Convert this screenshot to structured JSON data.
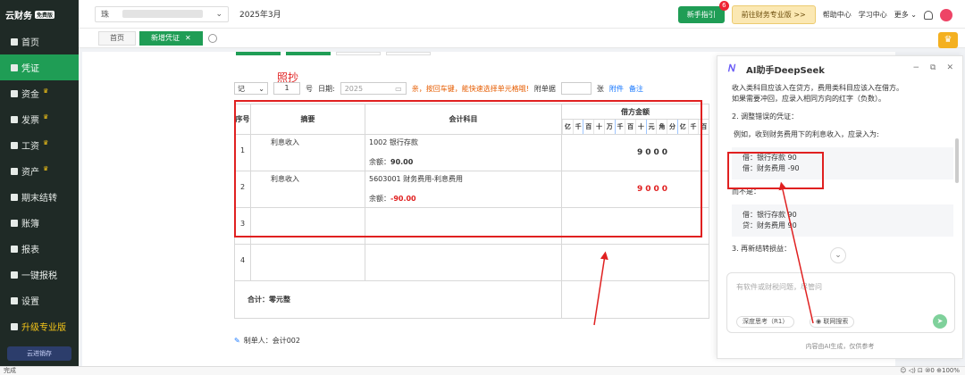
{
  "sidebar": {
    "logo": "云财务",
    "logo_badge": "免费版",
    "items": [
      {
        "label": "首页",
        "icon": "home-icon",
        "crown": false
      },
      {
        "label": "凭证",
        "icon": "voucher-icon",
        "crown": false
      },
      {
        "label": "资金",
        "icon": "fund-icon",
        "crown": true
      },
      {
        "label": "发票",
        "icon": "invoice-icon",
        "crown": true
      },
      {
        "label": "工资",
        "icon": "salary-icon",
        "crown": true
      },
      {
        "label": "资产",
        "icon": "asset-icon",
        "crown": true
      },
      {
        "label": "期末结转",
        "icon": "closing-icon",
        "crown": false
      },
      {
        "label": "账簿",
        "icon": "ledger-icon",
        "crown": false
      },
      {
        "label": "报表",
        "icon": "report-icon",
        "crown": false
      },
      {
        "label": "一键报税",
        "icon": "tax-icon",
        "crown": false
      },
      {
        "label": "设置",
        "icon": "settings-icon",
        "crown": false
      },
      {
        "label": "升级专业版",
        "icon": "crown-icon",
        "crown": false
      }
    ],
    "footer": "云进销存"
  },
  "topbar": {
    "company_prefix": "珠",
    "period": "2025年3月",
    "guide_btn": "新手指引",
    "guide_badge": "6",
    "pro_btn": "前往财务专业版 >>",
    "links": [
      "帮助中心",
      "学习中心",
      "更多"
    ]
  },
  "tabs": [
    "首页",
    "新增凭证"
  ],
  "form": {
    "word": "记",
    "number": "1",
    "number_label": "号",
    "date_label": "日期:",
    "date_value": "2025",
    "tip": "亲，按回车键，能快速选择单元格哦!",
    "attach_label": "附单据",
    "attach_unit": "张",
    "attach_link": "附件",
    "note_link": "备注",
    "annotation": "照抄"
  },
  "voucher": {
    "headers": {
      "seq": "序号",
      "summary": "摘要",
      "account": "会计科目",
      "debit": "借方金额"
    },
    "digit_headers": [
      "亿",
      "千",
      "百",
      "十",
      "万",
      "千",
      "百",
      "十",
      "元",
      "角",
      "分",
      "亿",
      "千",
      "百"
    ],
    "rows": [
      {
        "seq": "1",
        "summary": "利息收入",
        "account": "1002 银行存款",
        "balance_label": "余额：",
        "balance": "90.00",
        "amount": [
          "9",
          "0",
          "0",
          "0"
        ],
        "negative": false
      },
      {
        "seq": "2",
        "summary": "利息收入",
        "account": "5603001 财务费用-利息费用",
        "balance_label": "余额：",
        "balance": "-90.00",
        "amount": [
          "9",
          "0",
          "0",
          "0"
        ],
        "negative": true
      },
      {
        "seq": "3",
        "summary": "",
        "account": "",
        "balance_label": "",
        "balance": "",
        "amount": [],
        "negative": false
      },
      {
        "seq": "4",
        "summary": "",
        "account": "",
        "balance_label": "",
        "balance": "",
        "amount": [],
        "negative": false
      }
    ],
    "total_label": "合计：零元整"
  },
  "maker": "制单人：会计002",
  "ai": {
    "title": "AI助手DeepSeek",
    "lines_top": [
      "收入类科目应该入在贷方，费用类科目应该入在借方。",
      "如果需要冲回，应录入相同方向的红字（负数）。"
    ],
    "section2": "2. 调整错误的凭证：",
    "example": "例如，收到财务费用下的利息收入，应录入为:",
    "box1": [
      "借：银行存款 90",
      "借：财务费用 -90"
    ],
    "not_label": "而不是：",
    "box2": [
      "借：银行存款 90",
      "贷：财务费用 90"
    ],
    "section3": "3. 再新结转损益：",
    "placeholder": "有软件或财税问题，尽管问",
    "opt1": "深度思考（R1）",
    "opt2": "联网搜索",
    "footer": "内容由AI生成，仅供参考"
  },
  "status": {
    "left": "完成",
    "zoom": "100%",
    "count": "0"
  }
}
